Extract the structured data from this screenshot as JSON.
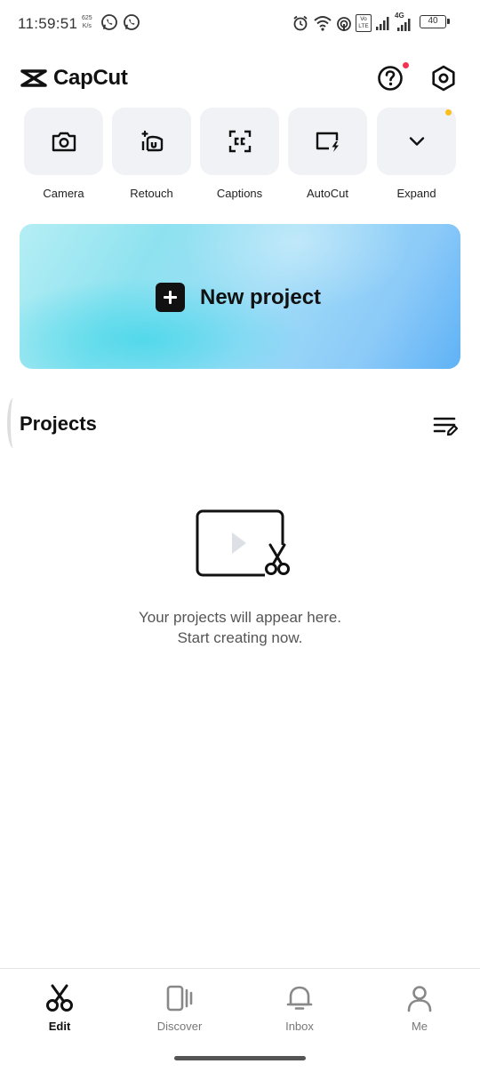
{
  "status_bar": {
    "time": "11:59:51",
    "net_speed_value": "625",
    "net_speed_unit": "K/s",
    "battery": "40",
    "network": "4G",
    "volte": "Vo LTE"
  },
  "header": {
    "app_name": "CapCut",
    "help_icon": "help-circle-icon",
    "settings_icon": "hexagon-settings-icon"
  },
  "tools": [
    {
      "label": "Camera",
      "icon": "camera-icon"
    },
    {
      "label": "Retouch",
      "icon": "retouch-icon"
    },
    {
      "label": "Captions",
      "icon": "captions-icon"
    },
    {
      "label": "AutoCut",
      "icon": "autocut-icon"
    },
    {
      "label": "Expand",
      "icon": "chevron-down-icon"
    }
  ],
  "new_project": {
    "label": "New project"
  },
  "projects": {
    "title": "Projects",
    "empty_line1": "Your projects will appear here.",
    "empty_line2": "Start creating now."
  },
  "bottom_nav": [
    {
      "label": "Edit",
      "icon": "scissors-icon",
      "active": true
    },
    {
      "label": "Discover",
      "icon": "discover-icon",
      "active": false
    },
    {
      "label": "Inbox",
      "icon": "bell-icon",
      "active": false
    },
    {
      "label": "Me",
      "icon": "person-icon",
      "active": false
    }
  ],
  "colors": {
    "notification_dot": "#f53152",
    "expand_dot": "#fbbf1d",
    "tile_bg": "#f0f2f5",
    "banner_start": "#b5eef4",
    "banner_end": "#5fb2f6"
  }
}
